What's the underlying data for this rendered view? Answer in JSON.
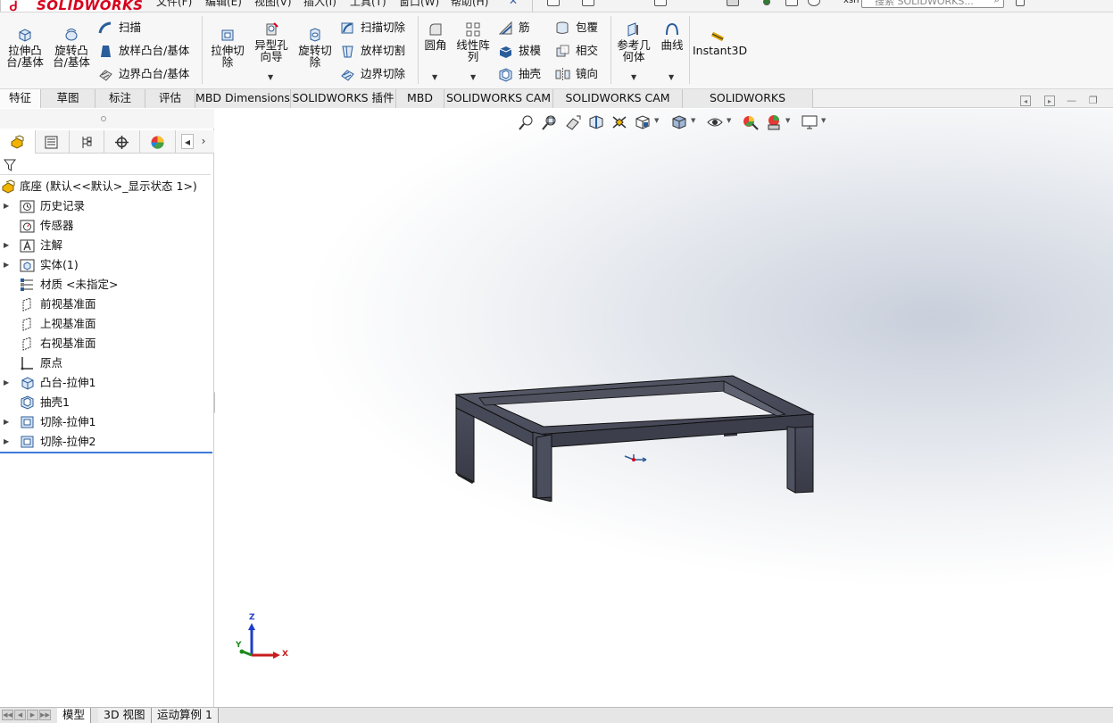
{
  "app": {
    "brand": "SOLIDWORKS",
    "menu": [
      "文件(F)",
      "编辑(E)",
      "视图(V)",
      "插入(I)",
      "工具(T)",
      "窗口(W)",
      "帮助(H)"
    ],
    "search_placeholder": "搜索 SOLIDWORKS...",
    "user_hint": "xsh"
  },
  "ribbon": {
    "extrude_boss": "拉伸凸\n台/基体",
    "revolve_boss": "旋转凸\n台/基体",
    "sweep": "扫描",
    "loft_boss": "放样凸台/基体",
    "boundary_boss": "边界凸台/基体",
    "extrude_cut": "拉伸切\n除",
    "hole_wizard": "异型孔\n向导",
    "revolve_cut": "旋转切\n除",
    "swept_cut": "扫描切除",
    "lofted_cut": "放样切割",
    "boundary_cut": "边界切除",
    "fillet": "圆角",
    "linear_pattern": "线性阵\n列",
    "rib": "筋",
    "draft": "拔模",
    "shell": "抽壳",
    "wrap": "包覆",
    "intersect": "相交",
    "mirror": "镜向",
    "ref_geometry": "参考几\n何体",
    "curves": "曲线",
    "instant3d": "Instant3D"
  },
  "tabs": [
    "特征",
    "草图",
    "标注",
    "评估",
    "MBD Dimensions",
    "SOLIDWORKS 插件",
    "MBD",
    "SOLIDWORKS CAM",
    "SOLIDWORKS CAM TBM",
    "SOLIDWORKS Inspection"
  ],
  "tree": {
    "root": "底座 (默认<<默认>_显示状态 1>)",
    "items": [
      {
        "label": "历史记录",
        "expandable": true
      },
      {
        "label": "传感器",
        "expandable": false
      },
      {
        "label": "注解",
        "expandable": true
      },
      {
        "label": "实体(1)",
        "expandable": true
      },
      {
        "label": "材质 <未指定>",
        "expandable": false
      },
      {
        "label": "前视基准面",
        "expandable": false
      },
      {
        "label": "上视基准面",
        "expandable": false
      },
      {
        "label": "右视基准面",
        "expandable": false
      },
      {
        "label": "原点",
        "expandable": false
      },
      {
        "label": "凸台-拉伸1",
        "expandable": true
      },
      {
        "label": "抽壳1",
        "expandable": false
      },
      {
        "label": "切除-拉伸1",
        "expandable": true
      },
      {
        "label": "切除-拉伸2",
        "expandable": true
      }
    ]
  },
  "triad": {
    "x": "X",
    "y": "Y",
    "z": "Z"
  },
  "bottom_tabs": [
    "模型",
    "3D 视图",
    "运动算例 1"
  ],
  "colors": {
    "brand_red": "#d6001c",
    "model_gray": "#4a4d5a",
    "tree_divider_blue": "#3d7bd6"
  }
}
